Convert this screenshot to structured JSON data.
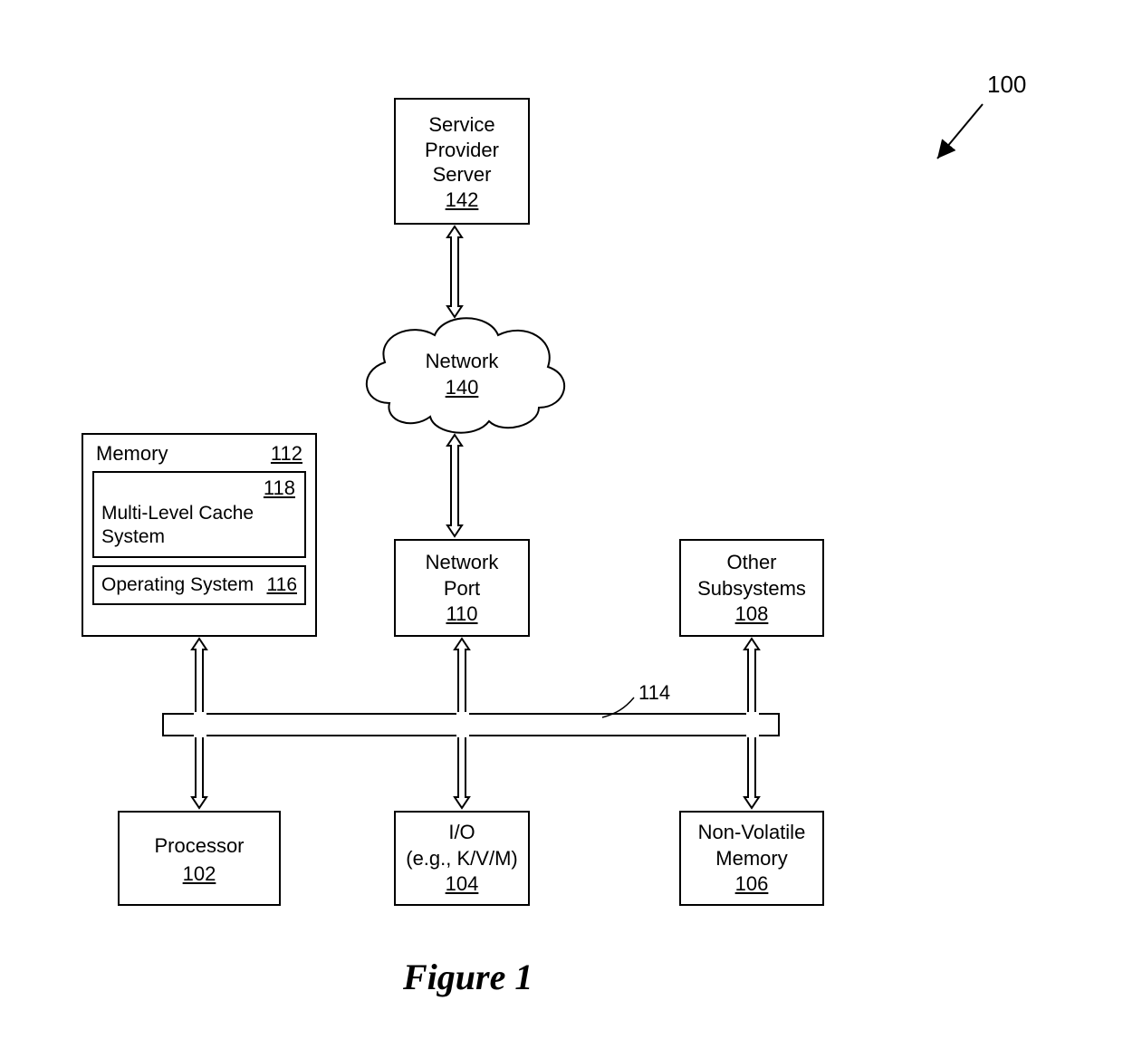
{
  "figure_ref": "100",
  "caption": "Figure 1",
  "blocks": {
    "server": {
      "line1": "Service",
      "line2": "Provider",
      "line3": "Server",
      "ref": "142"
    },
    "network": {
      "label": "Network",
      "ref": "140"
    },
    "memory": {
      "label": "Memory",
      "ref": "112",
      "cache": {
        "label": "Multi-Level Cache System",
        "ref": "118"
      },
      "os": {
        "label": "Operating System",
        "ref": "116"
      }
    },
    "netport": {
      "line1": "Network",
      "line2": "Port",
      "ref": "110"
    },
    "other": {
      "line1": "Other",
      "line2": "Subsystems",
      "ref": "108"
    },
    "processor": {
      "label": "Processor",
      "ref": "102"
    },
    "io": {
      "line1": "I/O",
      "line2": "(e.g., K/V/M)",
      "ref": "104"
    },
    "nvm": {
      "line1": "Non-Volatile",
      "line2": "Memory",
      "ref": "106"
    },
    "bus_ref": "114"
  }
}
